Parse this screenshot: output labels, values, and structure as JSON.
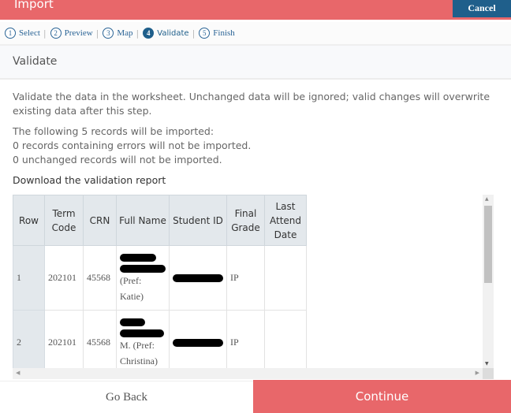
{
  "header": {
    "title": "Import",
    "cancel_label": "Cancel"
  },
  "steps": [
    {
      "num": "1",
      "label": "Select",
      "active": false
    },
    {
      "num": "2",
      "label": "Preview",
      "active": false
    },
    {
      "num": "3",
      "label": "Map",
      "active": false
    },
    {
      "num": "4",
      "label": "Validate",
      "active": true
    },
    {
      "num": "5",
      "label": "Finish",
      "active": false
    }
  ],
  "section": {
    "title": "Validate"
  },
  "description": "Validate the data in the worksheet. Unchanged data will be ignored; valid changes will overwrite existing data after this step.",
  "summary": [
    "The following 5 records will be imported:",
    "0 records containing errors will not be imported.",
    "0 unchanged records will not be imported."
  ],
  "download_link": "Download the validation report",
  "table": {
    "headers": [
      "Row",
      "Term Code",
      "CRN",
      "Full Name",
      "Student ID",
      "Final Grade",
      "Last Attend Date"
    ],
    "rows": [
      {
        "row": "1",
        "term_code": "202101",
        "crn": "45568",
        "full_name_visible": "(Pref: Katie)",
        "student_id": "[redacted]",
        "final_grade": "IP",
        "last_attend_date": ""
      },
      {
        "row": "2",
        "term_code": "202101",
        "crn": "45568",
        "full_name_visible": "M. (Pref: Christina)",
        "student_id": "[redacted]",
        "final_grade": "IP",
        "last_attend_date": ""
      }
    ]
  },
  "footer": {
    "back_label": "Go Back",
    "continue_label": "Continue"
  },
  "colors": {
    "brand": "#e8676a",
    "cancel": "#1f5f8b",
    "step_active": "#1f5f8b"
  }
}
